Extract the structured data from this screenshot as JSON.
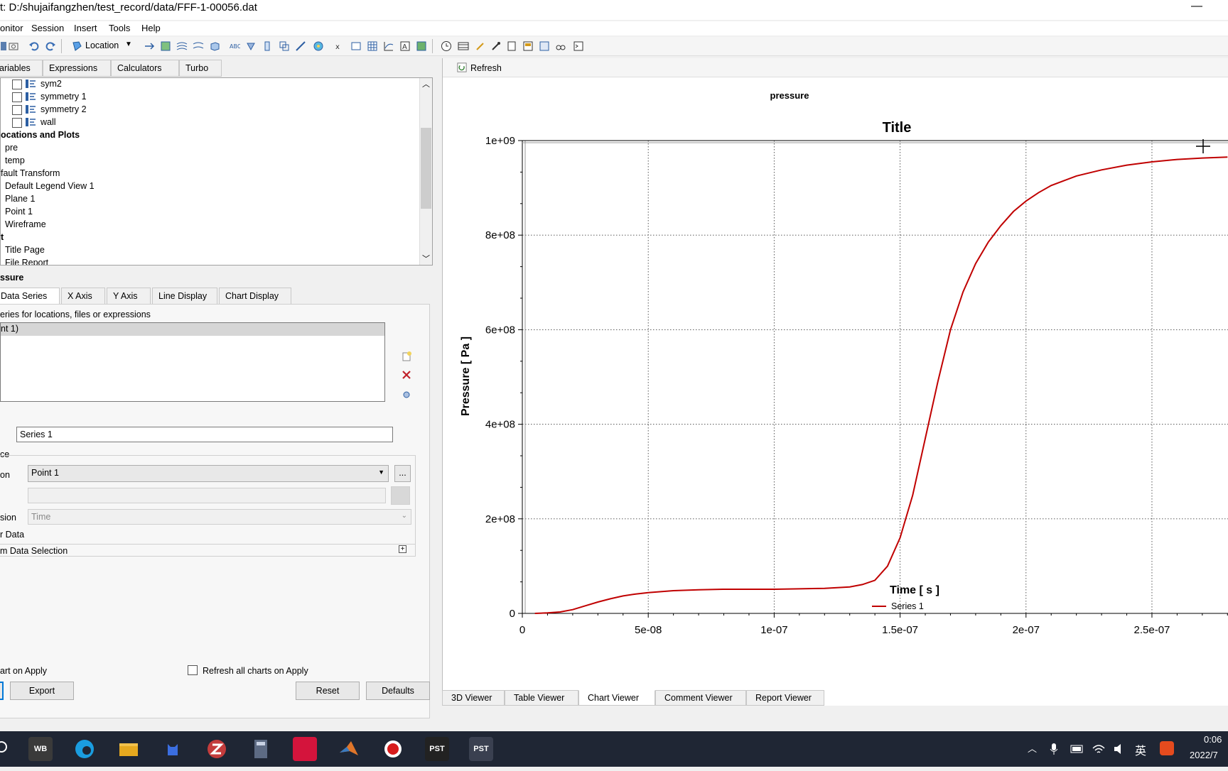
{
  "window": {
    "title": "t: D:/shujaifangzhen/test_record/data/FFF-1-00056.dat",
    "minimize_glyph": "—"
  },
  "menu": [
    "onitor",
    "Session",
    "Insert",
    "Tools",
    "Help"
  ],
  "toolbar": {
    "location_label": "Location"
  },
  "top_tabs": [
    "ariables",
    "Expressions",
    "Calculators",
    "Turbo"
  ],
  "tree": [
    {
      "label": "sym2",
      "checkbox": true,
      "indent": 1
    },
    {
      "label": "symmetry 1",
      "checkbox": true,
      "indent": 1
    },
    {
      "label": "symmetry 2",
      "checkbox": true,
      "indent": 1
    },
    {
      "label": "wall",
      "checkbox": true,
      "indent": 1
    },
    {
      "label": "ocations and Plots",
      "checkbox": false,
      "bold": true,
      "indent": 0
    },
    {
      "label": "pre",
      "checkbox": false,
      "indent": 0.5
    },
    {
      "label": "temp",
      "checkbox": false,
      "indent": 0.5
    },
    {
      "label": "fault Transform",
      "checkbox": false,
      "indent": 0
    },
    {
      "label": "Default Legend View 1",
      "checkbox": false,
      "indent": 0.5
    },
    {
      "label": "Plane 1",
      "checkbox": false,
      "indent": 0.5
    },
    {
      "label": "Point 1",
      "checkbox": false,
      "indent": 0.5
    },
    {
      "label": "Wireframe",
      "checkbox": false,
      "indent": 0.5
    },
    {
      "label": "t",
      "checkbox": false,
      "bold": true,
      "indent": 0
    },
    {
      "label": "Title Page",
      "checkbox": false,
      "indent": 0.5
    },
    {
      "label": "File Report",
      "checkbox": false,
      "indent": 0.5
    }
  ],
  "details": {
    "object_name": "ssure",
    "tabs": [
      "Data Series",
      "X Axis",
      "Y Axis",
      "Line Display",
      "Chart Display"
    ],
    "series_caption": "eries for locations, files or expressions",
    "series_list": [
      "nt 1)"
    ],
    "name_value": "Series 1",
    "group_label": "ce",
    "location_label": "on",
    "location_value": "Point 1",
    "browse_label": "...",
    "expression_label": "sion",
    "expression_value": "Time",
    "user_data_label": "r Data",
    "custom_data_label": "m Data Selection",
    "auto_label": "art on Apply",
    "refresh_all_label": "Refresh all charts on Apply",
    "export_label": "Export",
    "reset_label": "Reset",
    "defaults_label": "Defaults"
  },
  "viewer": {
    "refresh_label": "Refresh",
    "chart_name": "pressure",
    "tabs": [
      "3D Viewer",
      "Table Viewer",
      "Chart Viewer",
      "Comment Viewer",
      "Report Viewer"
    ],
    "active_tab": "Chart Viewer"
  },
  "taskbar": {
    "apps": [
      "WB",
      "PST",
      "PST"
    ],
    "ime": "英",
    "time": "0:06",
    "date": "2022/7"
  },
  "colors": {
    "series": "#c00000",
    "accent": "#0078d7",
    "taskbar": "#1f2634"
  },
  "chart_data": {
    "type": "line",
    "title": "Title",
    "xlabel": "Time [ s ]",
    "ylabel": "Pressure [ Pa ]",
    "xlim": [
      0,
      2.85e-07
    ],
    "ylim": [
      0,
      1000000000.0
    ],
    "xticks": [
      0,
      5e-08,
      1e-07,
      1.5e-07,
      2e-07,
      2.5e-07
    ],
    "xtick_labels": [
      "0",
      "5e-08",
      "1e-07",
      "1.5e-07",
      "2e-07",
      "2.5e-07"
    ],
    "yticks": [
      0,
      200000000.0,
      400000000.0,
      600000000.0,
      800000000.0,
      1000000000.0
    ],
    "ytick_labels": [
      "0",
      "2e+08",
      "4e+08",
      "6e+08",
      "8e+08",
      "1e+09"
    ],
    "grid": true,
    "legend_position": "bottom",
    "series": [
      {
        "name": "Series 1",
        "x": [
          5e-09,
          1e-08,
          1.5e-08,
          2e-08,
          2.5e-08,
          3e-08,
          3.5e-08,
          4e-08,
          4.5e-08,
          5e-08,
          6e-08,
          7e-08,
          8e-08,
          9e-08,
          1e-07,
          1.1e-07,
          1.2e-07,
          1.3e-07,
          1.35e-07,
          1.4e-07,
          1.45e-07,
          1.5e-07,
          1.55e-07,
          1.6e-07,
          1.65e-07,
          1.7e-07,
          1.75e-07,
          1.8e-07,
          1.85e-07,
          1.9e-07,
          1.95e-07,
          2e-07,
          2.05e-07,
          2.1e-07,
          2.2e-07,
          2.3e-07,
          2.4e-07,
          2.5e-07,
          2.6e-07,
          2.7e-07,
          2.8e-07
        ],
        "y": [
          0,
          1000000.0,
          3000000.0,
          8000000.0,
          16000000.0,
          24000000.0,
          31000000.0,
          37000000.0,
          41000000.0,
          44000000.0,
          48000000.0,
          50000000.0,
          51000000.0,
          51000000.0,
          51000000.0,
          52000000.0,
          53000000.0,
          56000000.0,
          61000000.0,
          70000000.0,
          100000000.0,
          160000000.0,
          250000000.0,
          370000000.0,
          490000000.0,
          600000000.0,
          680000000.0,
          740000000.0,
          785000000.0,
          820000000.0,
          850000000.0,
          872000000.0,
          890000000.0,
          905000000.0,
          925000000.0,
          938000000.0,
          948000000.0,
          955000000.0,
          960000000.0,
          963000000.0,
          965000000.0
        ]
      }
    ]
  }
}
